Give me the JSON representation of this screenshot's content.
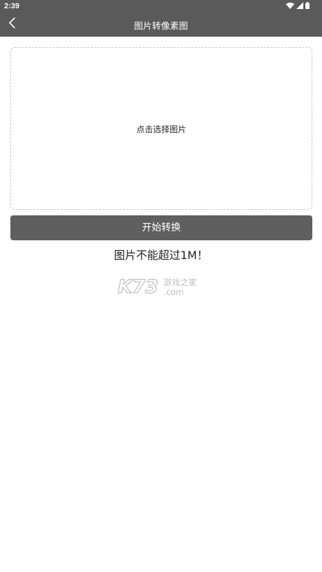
{
  "status_bar": {
    "time": "2:39",
    "icons": [
      "wifi-icon",
      "signal-icon",
      "battery-icon"
    ]
  },
  "app_bar": {
    "title": "图片转像素图",
    "back_icon": "chevron-left-icon"
  },
  "upload": {
    "label": "点击选择图片"
  },
  "convert_button": {
    "label": "开始转换"
  },
  "note": {
    "text": "图片不能超过1M！"
  },
  "watermark": {
    "brand": "K73",
    "cn": "游戏之家",
    "domain": ".com"
  },
  "colors": {
    "bar": "#5a5a5a",
    "button": "#5f5f5f",
    "dashed_border": "#c8c8c8"
  }
}
